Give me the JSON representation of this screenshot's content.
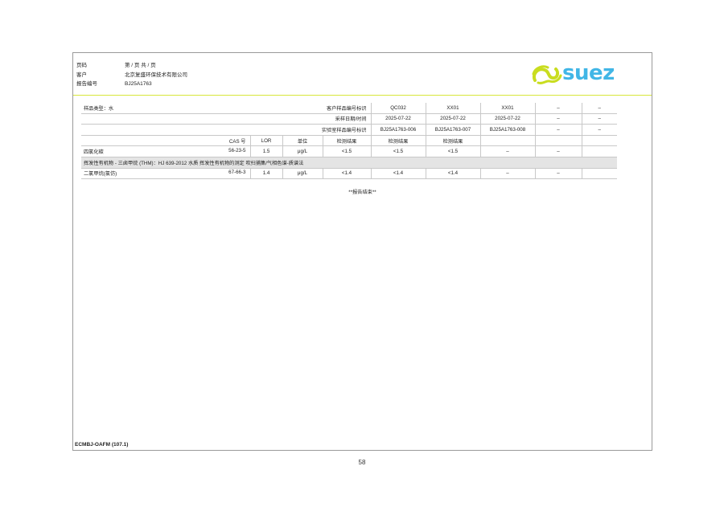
{
  "header": {
    "page_label": "页码",
    "page_value": "第 / 页 共 / 页",
    "client_label": "客户",
    "client_value": "北京复盛环保技术有限公司",
    "report_label": "报告编号",
    "report_value": "BJ25A1763"
  },
  "brand": {
    "name": "suez",
    "green": "#c9dd1f",
    "blue": "#41b6e6"
  },
  "table": {
    "sample_type": "样品类型：水",
    "client_id_label": "客户样品编号标识",
    "client_ids": [
      "QC032",
      "XX01",
      "XX01",
      "–",
      "–"
    ],
    "date_label": "采样日期/时间",
    "dates": [
      "2025-07-22",
      "2025-07-22",
      "2025-07-22",
      "–",
      "–"
    ],
    "lab_id_label": "实验室样品编号标识",
    "lab_ids": [
      "BJ25A1763-006",
      "BJ25A1763-007",
      "BJ25A1763-008",
      "–",
      "–"
    ],
    "col_headers": {
      "cas": "CAS 号",
      "lor": "LOR",
      "unit": "单位"
    },
    "results_label": [
      "检测结果",
      "检测结果",
      "检测结果"
    ],
    "rows": [
      {
        "name": "四氯化碳",
        "cas": "56-23-5",
        "lor": "1.5",
        "unit": "μg/L",
        "values": [
          "<1.5",
          "<1.5",
          "<1.5",
          "–",
          "–"
        ]
      }
    ],
    "group_title": "挥发性有机物 - 三卤甲烷 (THM)：HJ 639-2012 水质 挥发性有机物的测定 吹扫捕集/气相色谱-质谱法",
    "group_rows": [
      {
        "name": "二氯甲烷(氯仿)",
        "cas": "67-66-3",
        "lor": "1.4",
        "unit": "μg/L",
        "values": [
          "<1.4",
          "<1.4",
          "<1.4",
          "–",
          "–"
        ]
      }
    ]
  },
  "end_note": "**报告结束**",
  "footer_code": "ECMBJ-OAFM (107.1)",
  "page_number": "58"
}
